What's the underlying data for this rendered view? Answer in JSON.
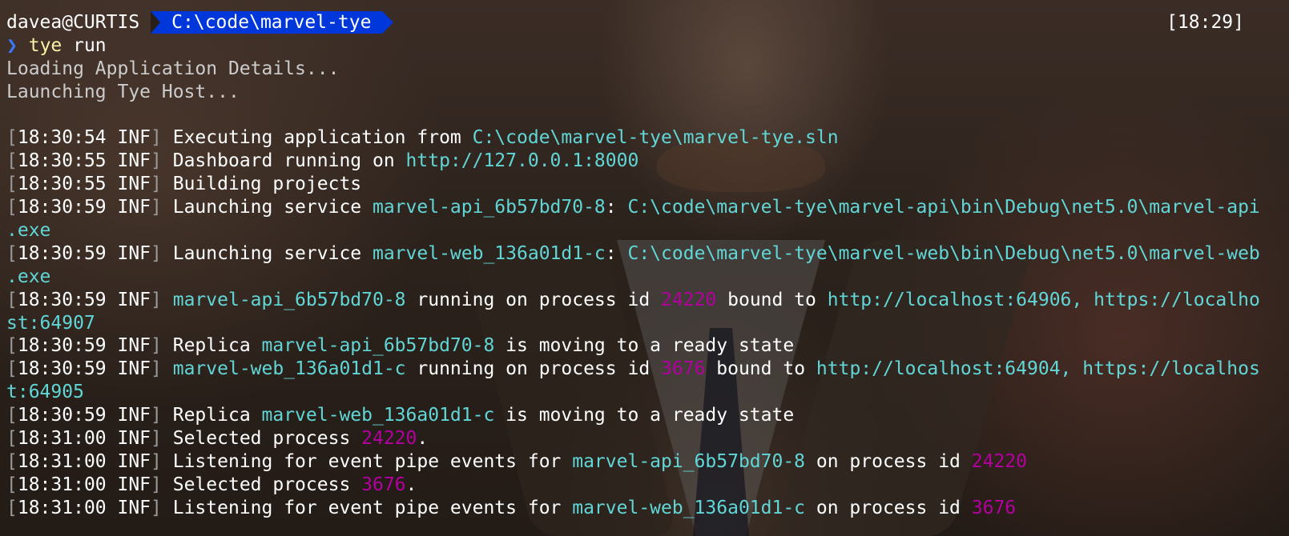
{
  "prompt": {
    "user_host": "davea@CURTIS",
    "path": "C:\\code\\marvel-tye",
    "clock": "[18:29]",
    "chevron": "❯",
    "command": "tye",
    "command_args": " run"
  },
  "status_lines": [
    "Loading Application Details...",
    "Launching Tye Host..."
  ],
  "log": [
    {
      "ts": "18:30:54",
      "level": "INF",
      "segs": [
        {
          "t": "Executing application from ",
          "c": "white"
        },
        {
          "t": "C:\\code\\marvel-tye\\marvel-tye.sln",
          "c": "cyan"
        }
      ]
    },
    {
      "ts": "18:30:55",
      "level": "INF",
      "segs": [
        {
          "t": "Dashboard running on ",
          "c": "white"
        },
        {
          "t": "http://127.0.0.1:8000",
          "c": "cyan"
        }
      ]
    },
    {
      "ts": "18:30:55",
      "level": "INF",
      "segs": [
        {
          "t": "Building projects",
          "c": "white"
        }
      ]
    },
    {
      "ts": "18:30:59",
      "level": "INF",
      "segs": [
        {
          "t": "Launching service ",
          "c": "white"
        },
        {
          "t": "marvel-api_6b57bd70-8",
          "c": "cyan"
        },
        {
          "t": ": ",
          "c": "white"
        },
        {
          "t": "C:\\code\\marvel-tye\\marvel-api\\bin\\Debug\\net5.0\\marvel-api",
          "c": "cyan"
        }
      ],
      "wrap": [
        {
          "t": ".exe",
          "c": "cyan"
        }
      ]
    },
    {
      "ts": "18:30:59",
      "level": "INF",
      "segs": [
        {
          "t": "Launching service ",
          "c": "white"
        },
        {
          "t": "marvel-web_136a01d1-c",
          "c": "cyan"
        },
        {
          "t": ": ",
          "c": "white"
        },
        {
          "t": "C:\\code\\marvel-tye\\marvel-web\\bin\\Debug\\net5.0\\marvel-web",
          "c": "cyan"
        }
      ],
      "wrap": [
        {
          "t": ".exe",
          "c": "cyan"
        }
      ]
    },
    {
      "ts": "18:30:59",
      "level": "INF",
      "segs": [
        {
          "t": "marvel-api_6b57bd70-8",
          "c": "cyan"
        },
        {
          "t": " running on process id ",
          "c": "white"
        },
        {
          "t": "24220",
          "c": "magenta"
        },
        {
          "t": " bound to ",
          "c": "white"
        },
        {
          "t": "http://localhost:64906, https://localho",
          "c": "cyan"
        }
      ],
      "wrap": [
        {
          "t": "st:64907",
          "c": "cyan"
        }
      ]
    },
    {
      "ts": "18:30:59",
      "level": "INF",
      "segs": [
        {
          "t": "Replica ",
          "c": "white"
        },
        {
          "t": "marvel-api_6b57bd70-8",
          "c": "cyan"
        },
        {
          "t": " is moving to a ready state",
          "c": "white"
        }
      ]
    },
    {
      "ts": "18:30:59",
      "level": "INF",
      "segs": [
        {
          "t": "marvel-web_136a01d1-c",
          "c": "cyan"
        },
        {
          "t": " running on process id ",
          "c": "white"
        },
        {
          "t": "3676",
          "c": "magenta"
        },
        {
          "t": " bound to ",
          "c": "white"
        },
        {
          "t": "http://localhost:64904, https://localhos",
          "c": "cyan"
        }
      ],
      "wrap": [
        {
          "t": "t:64905",
          "c": "cyan"
        }
      ]
    },
    {
      "ts": "18:30:59",
      "level": "INF",
      "segs": [
        {
          "t": "Replica ",
          "c": "white"
        },
        {
          "t": "marvel-web_136a01d1-c",
          "c": "cyan"
        },
        {
          "t": " is moving to a ready state",
          "c": "white"
        }
      ]
    },
    {
      "ts": "18:31:00",
      "level": "INF",
      "segs": [
        {
          "t": "Selected process ",
          "c": "white"
        },
        {
          "t": "24220",
          "c": "magenta"
        },
        {
          "t": ".",
          "c": "white"
        }
      ]
    },
    {
      "ts": "18:31:00",
      "level": "INF",
      "segs": [
        {
          "t": "Listening for event pipe events for ",
          "c": "white"
        },
        {
          "t": "marvel-api_6b57bd70-8",
          "c": "cyan"
        },
        {
          "t": " on process id ",
          "c": "white"
        },
        {
          "t": "24220",
          "c": "magenta"
        }
      ]
    },
    {
      "ts": "18:31:00",
      "level": "INF",
      "segs": [
        {
          "t": "Selected process ",
          "c": "white"
        },
        {
          "t": "3676",
          "c": "magenta"
        },
        {
          "t": ".",
          "c": "white"
        }
      ]
    },
    {
      "ts": "18:31:00",
      "level": "INF",
      "segs": [
        {
          "t": "Listening for event pipe events for ",
          "c": "white"
        },
        {
          "t": "marvel-web_136a01d1-c",
          "c": "cyan"
        },
        {
          "t": " on process id ",
          "c": "white"
        },
        {
          "t": "3676",
          "c": "magenta"
        }
      ]
    }
  ],
  "colors": {
    "path_segment_bg": "#0037da",
    "cyan": "#61d6d6",
    "magenta": "#b4009e",
    "command": "#f9f1a5",
    "chevron": "#3b78ff"
  }
}
